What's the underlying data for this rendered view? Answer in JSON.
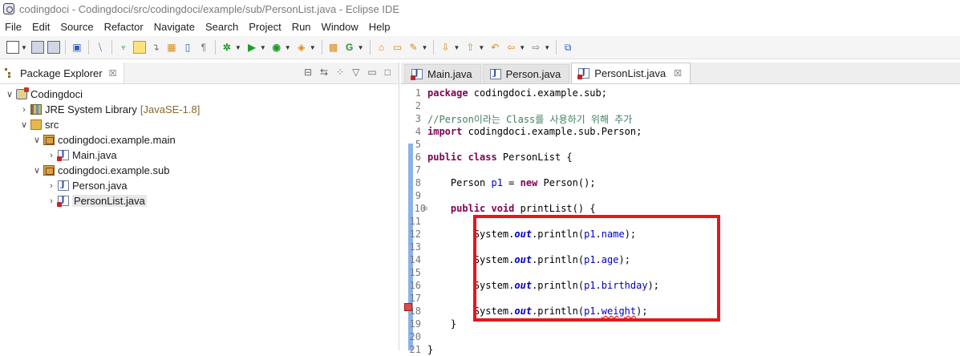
{
  "window": {
    "title": "codingdoci - Codingdoci/src/codingdoci/example/sub/PersonList.java - Eclipse IDE"
  },
  "menubar": [
    "File",
    "Edit",
    "Source",
    "Refactor",
    "Navigate",
    "Search",
    "Project",
    "Run",
    "Window",
    "Help"
  ],
  "package_explorer": {
    "title": "Package Explorer",
    "close": "☒",
    "tree": {
      "project": "Codingdoci",
      "library": "JRE System Library",
      "library_decoration": "[JavaSE-1.8]",
      "src": "src",
      "pkg_main": "codingdoci.example.main",
      "main_java": "Main.java",
      "pkg_sub": "codingdoci.example.sub",
      "person_java": "Person.java",
      "personlist_java": "PersonList.java"
    }
  },
  "editor": {
    "tabs": [
      {
        "label": "Main.java"
      },
      {
        "label": "Person.java"
      },
      {
        "label": "PersonList.java",
        "close": "☒"
      }
    ],
    "lines": [
      {
        "n": "1"
      },
      {
        "n": "2"
      },
      {
        "n": "3"
      },
      {
        "n": "4"
      },
      {
        "n": "5"
      },
      {
        "n": "6"
      },
      {
        "n": "7"
      },
      {
        "n": "8"
      },
      {
        "n": "9"
      },
      {
        "n": "10"
      },
      {
        "n": "11"
      },
      {
        "n": "12"
      },
      {
        "n": "13"
      },
      {
        "n": "14"
      },
      {
        "n": "15"
      },
      {
        "n": "16"
      },
      {
        "n": "17"
      },
      {
        "n": "18"
      },
      {
        "n": "19"
      },
      {
        "n": "20"
      },
      {
        "n": "21"
      }
    ],
    "code": {
      "l1_kw": "package",
      "l1_rest": " codingdoci.example.sub;",
      "l3_comment": "//Person이라는 Class를 사용하기 위해 추가",
      "l4_kw": "import",
      "l4_rest": " codingdoci.example.sub.Person;",
      "l6_kw": "public class",
      "l6_rest": " PersonList {",
      "l8_type": "    Person ",
      "l8_field": "p1",
      "l8_eq": " = ",
      "l8_kw": "new",
      "l8_rest": " Person();",
      "l10_kw": "    public void",
      "l10_rest": " printList() {",
      "sys": "        System.",
      "out": "out",
      "println": ".println(",
      "p1": "p1",
      "dot": ".",
      "name": "name",
      "age": "age",
      "birthday": "birthday",
      "weight": "weight",
      "end": ");",
      "l19": "    }",
      "l21": "}"
    }
  }
}
